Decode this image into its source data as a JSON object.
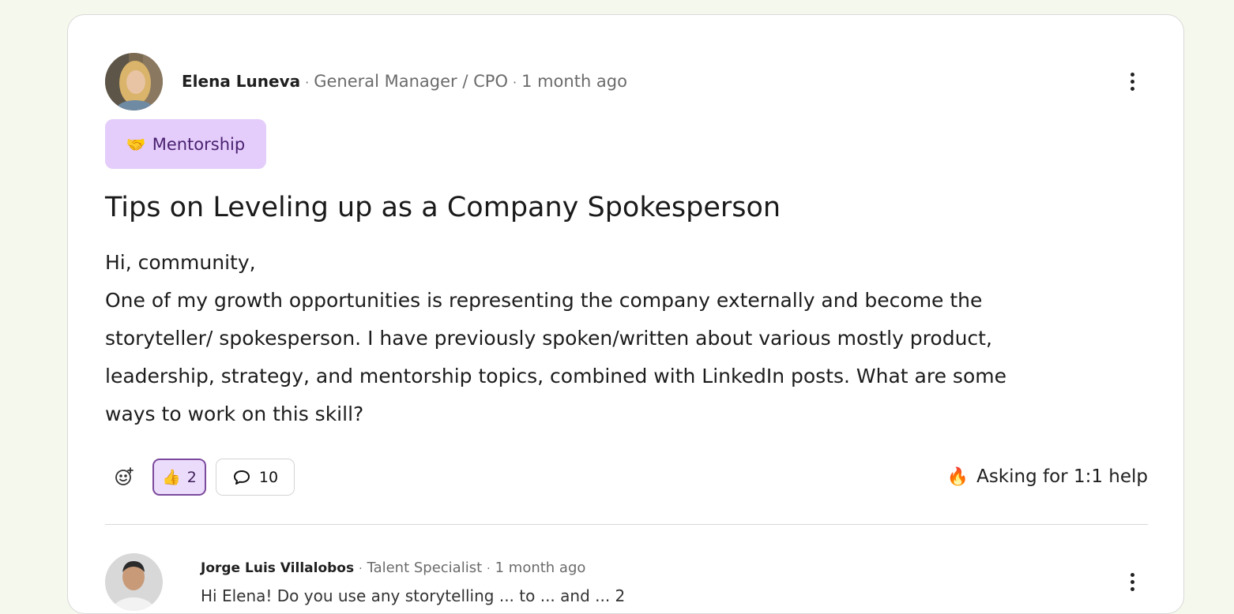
{
  "post": {
    "author": "Elena Luneva",
    "role": "General Manager / CPO",
    "time": "1 month ago",
    "separator": "·",
    "tag": {
      "emoji": "🤝",
      "label": "Mentorship"
    },
    "title": "Tips on Leveling up as a Company Spokesperson",
    "body_lines": [
      "Hi, community,",
      "One of my growth opportunities is representing the company externally and become the",
      "storyteller/ spokesperson. I have previously spoken/written about various mostly product,",
      "leadership, strategy, and mentorship topics, combined with LinkedIn posts. What are some",
      "ways to work on this skill?"
    ],
    "reactions": {
      "like_emoji": "👍",
      "like_count": "2",
      "comment_count": "10"
    },
    "help_badge": {
      "emoji": "🔥",
      "label": "Asking for 1:1 help"
    }
  },
  "comment": {
    "author": "Jorge Luis Villalobos",
    "role": "Talent Specialist",
    "time": "1 month ago",
    "separator": "·",
    "snippet": "Hi Elena! Do you use any storytelling ... to ... and ... 2"
  },
  "colors": {
    "page_bg": "#f5f8ec",
    "tag_bg": "#e4cdfb",
    "tag_text": "#4a2170",
    "like_bg": "#ecdcfc",
    "like_border": "#7b4a9c"
  }
}
